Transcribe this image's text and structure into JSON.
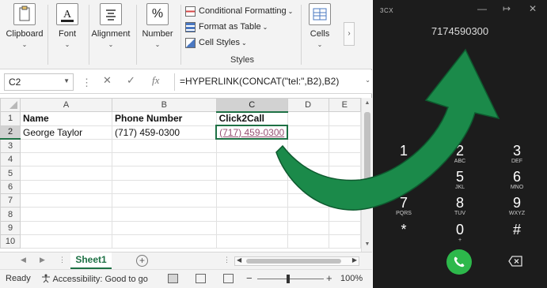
{
  "ribbon": {
    "clipboard": {
      "label": "Clipboard"
    },
    "font": {
      "label": "Font"
    },
    "alignment": {
      "label": "Alignment"
    },
    "number": {
      "label": "Number",
      "icon": "%"
    },
    "styles": {
      "conditional_formatting": "Conditional Formatting",
      "format_as_table": "Format as Table",
      "cell_styles": "Cell Styles",
      "group_label": "Styles"
    },
    "cells": {
      "label": "Cells"
    }
  },
  "formula_bar": {
    "name_box": "C2",
    "formula": "=HYPERLINK(CONCAT(\"tel:\",B2),B2)",
    "fx": "fx"
  },
  "grid": {
    "columns": [
      "A",
      "B",
      "C",
      "D",
      "E"
    ],
    "rows": [
      "1",
      "2",
      "3",
      "4",
      "5",
      "6",
      "7",
      "8",
      "9",
      "10"
    ],
    "header_row": {
      "name": "Name",
      "phone": "Phone Number",
      "click2call": "Click2Call"
    },
    "data_row": {
      "name": "George Taylor",
      "phone": "(717) 459-0300",
      "click2call": "(717) 459-0300"
    }
  },
  "sheet_tabs": {
    "active": "Sheet1",
    "add": "+"
  },
  "status_bar": {
    "ready": "Ready",
    "accessibility": "Accessibility: Good to go",
    "zoom": "100%",
    "zoom_minus": "−",
    "zoom_plus": "+"
  },
  "phone": {
    "brand": "3CX",
    "dialed_number": "7174590300",
    "keys": [
      {
        "digit": "1",
        "sub": ""
      },
      {
        "digit": "2",
        "sub": "ABC"
      },
      {
        "digit": "3",
        "sub": "DEF"
      },
      {
        "digit": "4",
        "sub": "GHI"
      },
      {
        "digit": "5",
        "sub": "JKL"
      },
      {
        "digit": "6",
        "sub": "MNO"
      },
      {
        "digit": "7",
        "sub": "PQRS"
      },
      {
        "digit": "8",
        "sub": "TUV"
      },
      {
        "digit": "9",
        "sub": "WXYZ"
      },
      {
        "digit": "*",
        "sub": ""
      },
      {
        "digit": "0",
        "sub": "+"
      },
      {
        "digit": "#",
        "sub": ""
      }
    ],
    "window_controls": {
      "minimize": "—",
      "pin": "↦",
      "close": "✕"
    }
  },
  "colors": {
    "excel_green": "#1e7145",
    "link": "#954f72",
    "call_green": "#2db84b",
    "arrow_green": "#1b8a4a",
    "phone_bg": "#1c1c1c"
  }
}
